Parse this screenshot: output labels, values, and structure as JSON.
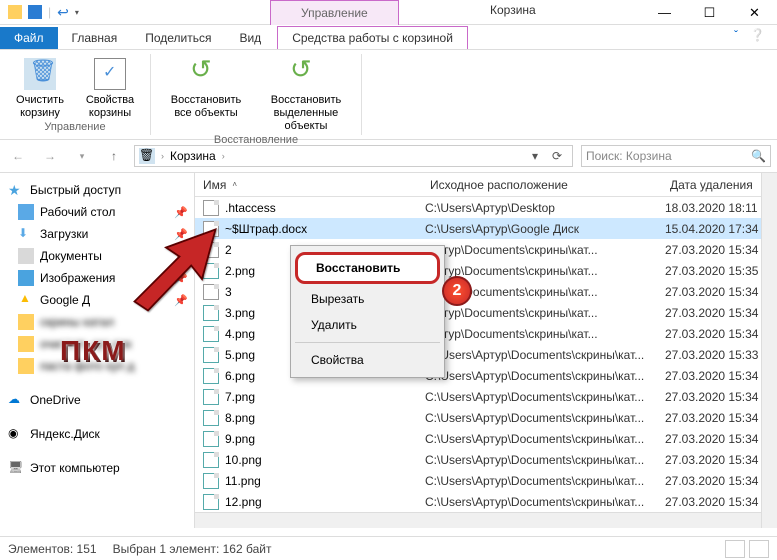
{
  "window": {
    "mgmt_tab": "Управление",
    "title": "Корзина"
  },
  "menu": {
    "file": "Файл",
    "home": "Главная",
    "share": "Поделиться",
    "view": "Вид",
    "tools": "Средства работы с корзиной"
  },
  "ribbon": {
    "empty": "Очистить\nкорзину",
    "props": "Свойства\nкорзины",
    "group1": "Управление",
    "restore_all": "Восстановить\nвсе объекты",
    "restore_sel": "Восстановить\nвыделенные объекты",
    "group2": "Восстановление"
  },
  "address": {
    "crumb": "Корзина",
    "search_placeholder": "Поиск: Корзина"
  },
  "nav": {
    "quick": "Быстрый доступ",
    "desktop": "Рабочий стол",
    "downloads": "Загрузки",
    "documents": "Документы",
    "pictures": "Изображения",
    "gdrive": "Google Д",
    "blur1": "скрины катал",
    "blur2": "очистить кук дек",
    "blur3": "паста фото куп д",
    "onedrive": "OneDrive",
    "yandex": "Яндекс.Диск",
    "thispc": "Этот компьютер"
  },
  "columns": {
    "name": "Имя",
    "location": "Исходное расположение",
    "deleted": "Дата удаления"
  },
  "files": [
    {
      "name": ".htaccess",
      "loc": "C:\\Users\\Артур\\Desktop",
      "date": "18.03.2020 18:11",
      "sel": false
    },
    {
      "name": "~$Штраф.docx",
      "loc": "C:\\Users\\Артур\\Google Диск",
      "date": "15.04.2020 17:34",
      "sel": true
    },
    {
      "name": "2",
      "loc": "\\Артур\\Documents\\скрины\\кат...",
      "date": "27.03.2020 15:34",
      "sel": false
    },
    {
      "name": "2.png",
      "loc": "\\Артур\\Documents\\скрины\\кат...",
      "date": "27.03.2020 15:35",
      "sel": false
    },
    {
      "name": "3",
      "loc": "\\Артур\\Documents\\скрины\\кат...",
      "date": "27.03.2020 15:34",
      "sel": false
    },
    {
      "name": "3.png",
      "loc": "\\Артур\\Documents\\скрины\\кат...",
      "date": "27.03.2020 15:34",
      "sel": false
    },
    {
      "name": "4.png",
      "loc": "\\Артур\\Documents\\скрины\\кат...",
      "date": "27.03.2020 15:34",
      "sel": false
    },
    {
      "name": "5.png",
      "loc": "C:\\Users\\Артур\\Documents\\скрины\\кат...",
      "date": "27.03.2020 15:33",
      "sel": false
    },
    {
      "name": "6.png",
      "loc": "C:\\Users\\Артур\\Documents\\скрины\\кат...",
      "date": "27.03.2020 15:34",
      "sel": false
    },
    {
      "name": "7.png",
      "loc": "C:\\Users\\Артур\\Documents\\скрины\\кат...",
      "date": "27.03.2020 15:34",
      "sel": false
    },
    {
      "name": "8.png",
      "loc": "C:\\Users\\Артур\\Documents\\скрины\\кат...",
      "date": "27.03.2020 15:34",
      "sel": false
    },
    {
      "name": "9.png",
      "loc": "C:\\Users\\Артур\\Documents\\скрины\\кат...",
      "date": "27.03.2020 15:34",
      "sel": false
    },
    {
      "name": "10.png",
      "loc": "C:\\Users\\Артур\\Documents\\скрины\\кат...",
      "date": "27.03.2020 15:34",
      "sel": false
    },
    {
      "name": "11.png",
      "loc": "C:\\Users\\Артур\\Documents\\скрины\\кат...",
      "date": "27.03.2020 15:34",
      "sel": false
    },
    {
      "name": "12.png",
      "loc": "C:\\Users\\Артур\\Documents\\скрины\\кат...",
      "date": "27.03.2020 15:34",
      "sel": false
    }
  ],
  "ctx": {
    "restore": "Восстановить",
    "cut": "Вырезать",
    "delete": "Удалить",
    "props": "Свойства"
  },
  "badge": "2",
  "pkm": "ПКМ",
  "status": {
    "count": "Элементов: 151",
    "sel": "Выбран 1 элемент: 162 байт"
  }
}
